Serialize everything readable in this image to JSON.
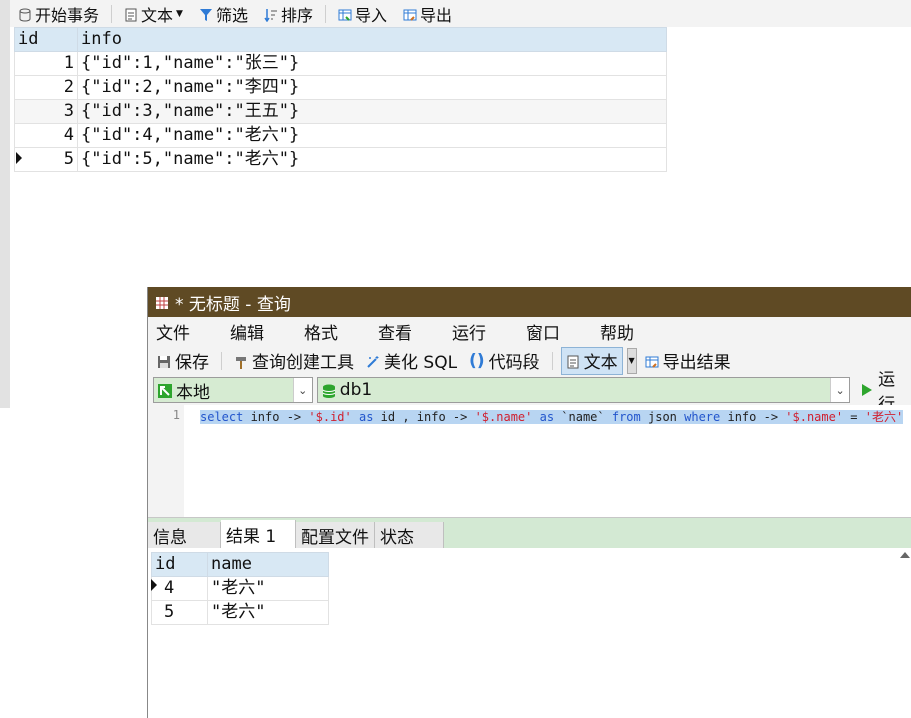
{
  "toolbar": {
    "begin_transaction": "开始事务",
    "text": "文本",
    "filter": "筛选",
    "sort": "排序",
    "import": "导入",
    "export": "导出"
  },
  "table": {
    "columns": [
      "id",
      "info"
    ],
    "rows": [
      {
        "id": "1",
        "info": "{\"id\":1,\"name\":\"张三\"}"
      },
      {
        "id": "2",
        "info": "{\"id\":2,\"name\":\"李四\"}"
      },
      {
        "id": "3",
        "info": "{\"id\":3,\"name\":\"王五\"}"
      },
      {
        "id": "4",
        "info": "{\"id\":4,\"name\":\"老六\"}"
      },
      {
        "id": "5",
        "info": "{\"id\":5,\"name\":\"老六\"}"
      }
    ]
  },
  "query_window": {
    "title": "* 无标题 - 查询",
    "menu": [
      "文件",
      "编辑",
      "格式",
      "查看",
      "运行",
      "窗口",
      "帮助"
    ],
    "toolbar": {
      "save": "保存",
      "query_builder": "查询创建工具",
      "beautify": "美化 SQL",
      "snippet": "代码段",
      "text": "文本",
      "export_result": "导出结果"
    },
    "connection": "本地",
    "database": "db1",
    "run": "运行",
    "line_number": "1",
    "sql": {
      "t1": "select",
      "t2": " info -> ",
      "t3": "'$.id'",
      "t4": " as ",
      "t5": "id , info -> ",
      "t6": "'$.name'",
      "t7": " as ",
      "t8": "`name` ",
      "t9": "from",
      "t10": " json ",
      "t11": "where",
      "t12": " info -> ",
      "t13": "'$.name'",
      "t14": " = ",
      "t15": "'老六'"
    },
    "result_tabs": [
      "信息",
      "结果 1",
      "配置文件",
      "状态"
    ],
    "result": {
      "columns": [
        "id",
        "name"
      ],
      "rows": [
        {
          "id": "4",
          "name": "\"老六\""
        },
        {
          "id": "5",
          "name": "\"老六\""
        }
      ]
    }
  }
}
